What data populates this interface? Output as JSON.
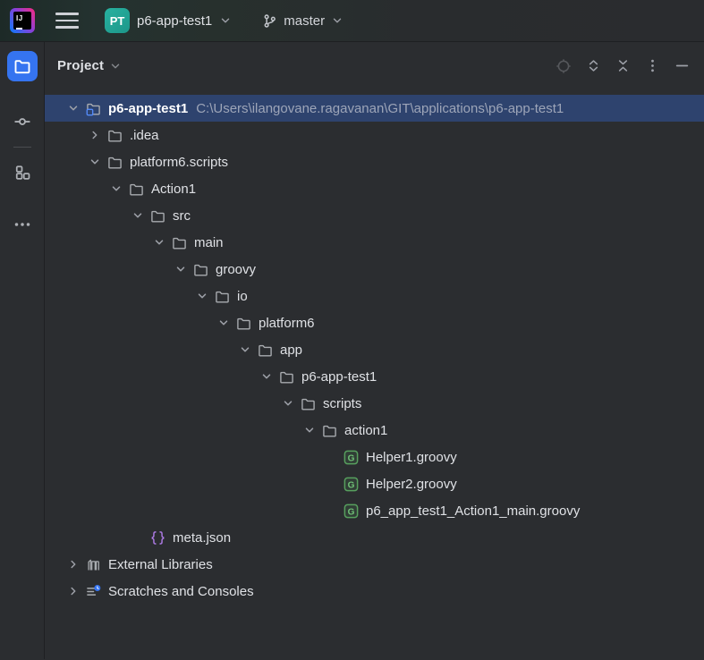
{
  "titlebar": {
    "app": "IntelliJ IDEA",
    "main_menu_icon": "hamburger",
    "project_switcher": {
      "badge": "PT",
      "name": "p6-app-test1"
    },
    "branch_switcher": {
      "branch": "master"
    }
  },
  "tool_stripe": {
    "items": [
      {
        "name": "project",
        "active": true
      },
      {
        "name": "commit",
        "active": false
      },
      {
        "name": "structure",
        "active": false
      },
      {
        "name": "more-tool-windows",
        "active": false
      }
    ]
  },
  "panel": {
    "title": "Project",
    "header_icons": [
      "select-opened-file",
      "expand-all",
      "collapse-all",
      "more-options",
      "hide-panel"
    ]
  },
  "tree": {
    "rows": [
      {
        "level": 0,
        "chevron": "down",
        "icon": "project-folder",
        "name": "p6-app-test1",
        "path": "C:\\Users\\ilangovane.ragavanan\\GIT\\applications\\p6-app-test1",
        "selected": true,
        "bold": true
      },
      {
        "level": 1,
        "chevron": "right",
        "icon": "folder",
        "name": ".idea"
      },
      {
        "level": 1,
        "chevron": "down",
        "icon": "folder",
        "name": "platform6.scripts"
      },
      {
        "level": 2,
        "chevron": "down",
        "icon": "folder",
        "name": "Action1"
      },
      {
        "level": 3,
        "chevron": "down",
        "icon": "folder",
        "name": "src"
      },
      {
        "level": 4,
        "chevron": "down",
        "icon": "folder",
        "name": "main"
      },
      {
        "level": 5,
        "chevron": "down",
        "icon": "folder",
        "name": "groovy"
      },
      {
        "level": 6,
        "chevron": "down",
        "icon": "folder",
        "name": "io"
      },
      {
        "level": 7,
        "chevron": "down",
        "icon": "folder",
        "name": "platform6"
      },
      {
        "level": 8,
        "chevron": "down",
        "icon": "folder",
        "name": "app"
      },
      {
        "level": 9,
        "chevron": "down",
        "icon": "folder",
        "name": "p6-app-test1"
      },
      {
        "level": 10,
        "chevron": "down",
        "icon": "folder",
        "name": "scripts"
      },
      {
        "level": 11,
        "chevron": "down",
        "icon": "folder",
        "name": "action1"
      },
      {
        "level": 12,
        "chevron": "none",
        "icon": "groovy",
        "name": "Helper1.groovy"
      },
      {
        "level": 12,
        "chevron": "none",
        "icon": "groovy",
        "name": "Helper2.groovy"
      },
      {
        "level": 12,
        "chevron": "none",
        "icon": "groovy",
        "name": "p6_app_test1_Action1_main.groovy"
      },
      {
        "level": 3,
        "chevron": "none",
        "icon": "json",
        "name": "meta.json"
      },
      {
        "level": 0,
        "chevron": "right",
        "icon": "library",
        "name": "External Libraries"
      },
      {
        "level": 0,
        "chevron": "right",
        "icon": "scratches",
        "name": "Scratches and Consoles"
      }
    ]
  },
  "colors": {
    "accent": "#3574f0",
    "selection": "#2e436e",
    "project_badge": "#21a38f",
    "groovy_icon": "#57a05e",
    "json_icon": "#a978df",
    "panel_bg": "#2b2d30"
  }
}
